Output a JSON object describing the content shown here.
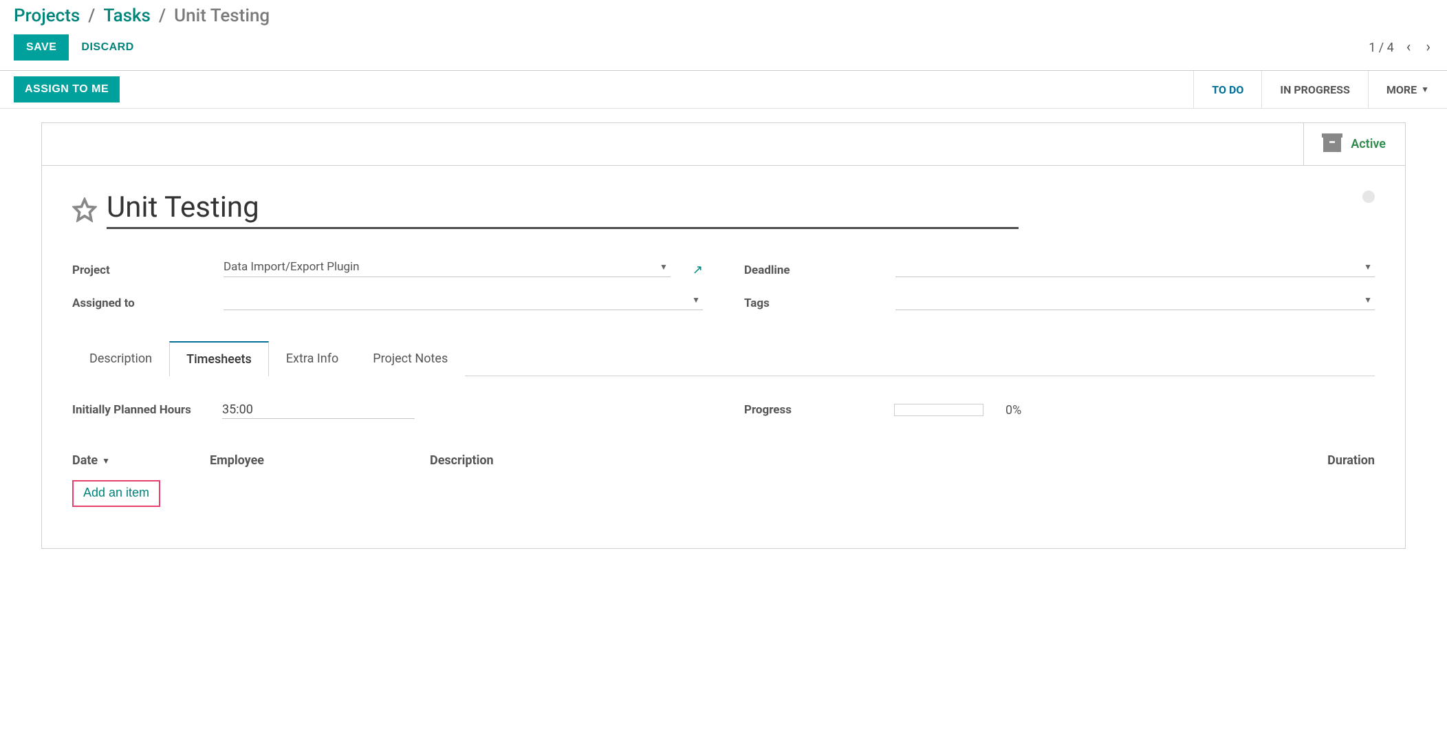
{
  "breadcrumb": {
    "projects": "Projects",
    "tasks": "Tasks",
    "current": "Unit Testing"
  },
  "buttons": {
    "save": "SAVE",
    "discard": "DISCARD",
    "assign_to_me": "ASSIGN TO ME"
  },
  "pager": {
    "text": "1 / 4"
  },
  "stages": {
    "todo": "TO DO",
    "in_progress": "IN PROGRESS",
    "more": "MORE"
  },
  "active_label": "Active",
  "task": {
    "title": "Unit Testing",
    "project_label": "Project",
    "project_value": "Data Import/Export Plugin",
    "assigned_label": "Assigned to",
    "assigned_value": "",
    "deadline_label": "Deadline",
    "deadline_value": "",
    "tags_label": "Tags",
    "tags_value": ""
  },
  "tabs": {
    "description": "Description",
    "timesheets": "Timesheets",
    "extra": "Extra Info",
    "notes": "Project Notes"
  },
  "timesheet": {
    "planned_label": "Initially Planned Hours",
    "planned_value": "35:00",
    "progress_label": "Progress",
    "progress_text": "0%",
    "columns": {
      "date": "Date",
      "employee": "Employee",
      "description": "Description",
      "duration": "Duration"
    },
    "add_item": "Add an item"
  }
}
